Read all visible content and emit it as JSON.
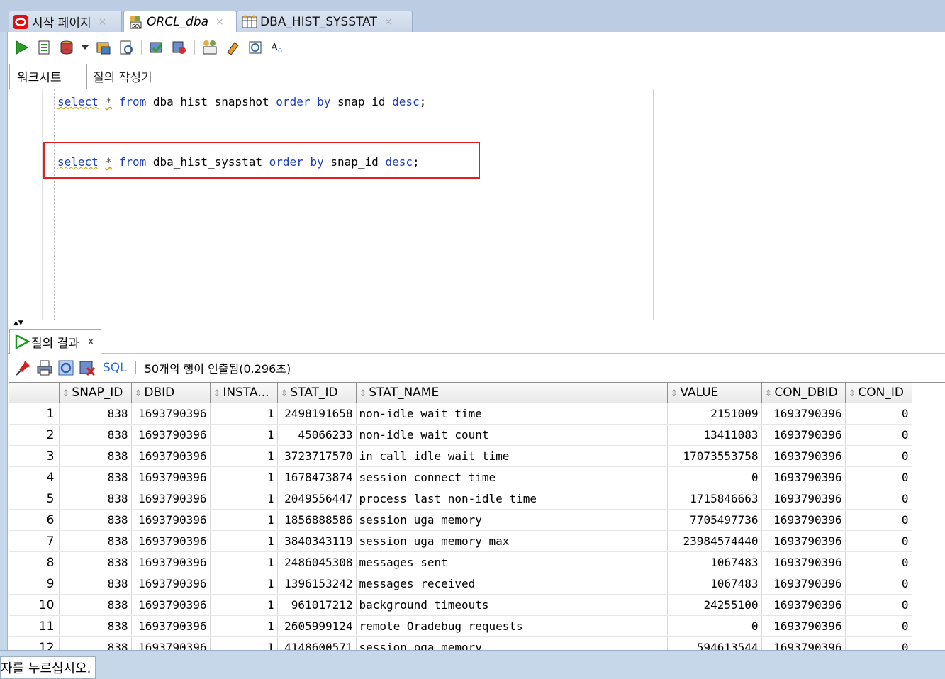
{
  "doc_tabs": [
    {
      "label": "시작 페이지",
      "icon": "oracle-logo-icon",
      "active": false
    },
    {
      "label": "ORCL_dba",
      "icon": "sql-connection-icon",
      "active": true
    },
    {
      "label": "DBA_HIST_SYSSTAT",
      "icon": "table-icon",
      "active": false
    }
  ],
  "worksheet_tabs": {
    "worksheet": "워크시트",
    "query_builder": "질의 작성기"
  },
  "editor": {
    "line1": {
      "select": "select",
      "star": "*",
      "from": "from",
      "table": "dba_hist_snapshot",
      "order": "order",
      "by": "by",
      "col": "snap_id",
      "desc": "desc",
      "semi": ";"
    },
    "line2": {
      "select": "select",
      "star": "*",
      "from": "from",
      "table": "dba_hist_sysstat",
      "order": "order",
      "by": "by",
      "col": "snap_id",
      "desc": "desc",
      "semi": ";"
    }
  },
  "results": {
    "tab_label": "질의 결과",
    "tab_close": "x",
    "sql_link": "SQL",
    "fetch_status": "50개의 행이 인출됨(0.296초)",
    "columns": [
      "SNAP_ID",
      "DBID",
      "INSTA...",
      "STAT_ID",
      "STAT_NAME",
      "VALUE",
      "CON_DBID",
      "CON_ID"
    ],
    "rows": [
      [
        "1",
        "838",
        "1693790396",
        "1",
        "2498191658",
        "non-idle wait time",
        "2151009",
        "1693790396",
        "0"
      ],
      [
        "2",
        "838",
        "1693790396",
        "1",
        "45066233",
        "non-idle wait count",
        "13411083",
        "1693790396",
        "0"
      ],
      [
        "3",
        "838",
        "1693790396",
        "1",
        "3723717570",
        "in call idle wait time",
        "17073553758",
        "1693790396",
        "0"
      ],
      [
        "4",
        "838",
        "1693790396",
        "1",
        "1678473874",
        "session connect time",
        "0",
        "1693790396",
        "0"
      ],
      [
        "5",
        "838",
        "1693790396",
        "1",
        "2049556447",
        "process last non-idle time",
        "1715846663",
        "1693790396",
        "0"
      ],
      [
        "6",
        "838",
        "1693790396",
        "1",
        "1856888586",
        "session uga memory",
        "7705497736",
        "1693790396",
        "0"
      ],
      [
        "7",
        "838",
        "1693790396",
        "1",
        "3840343119",
        "session uga memory max",
        "23984574440",
        "1693790396",
        "0"
      ],
      [
        "8",
        "838",
        "1693790396",
        "1",
        "2486045308",
        "messages sent",
        "1067483",
        "1693790396",
        "0"
      ],
      [
        "9",
        "838",
        "1693790396",
        "1",
        "1396153242",
        "messages received",
        "1067483",
        "1693790396",
        "0"
      ],
      [
        "10",
        "838",
        "1693790396",
        "1",
        "961017212",
        "background timeouts",
        "24255100",
        "1693790396",
        "0"
      ],
      [
        "11",
        "838",
        "1693790396",
        "1",
        "2605999124",
        "remote Oradebug requests",
        "0",
        "1693790396",
        "0"
      ],
      [
        "12",
        "838",
        "1693790396",
        "1",
        "4148600571",
        "session pga memory",
        "594613544",
        "1693790396",
        "0"
      ]
    ]
  },
  "status_bar": {
    "text": "자를 누르십시오."
  }
}
